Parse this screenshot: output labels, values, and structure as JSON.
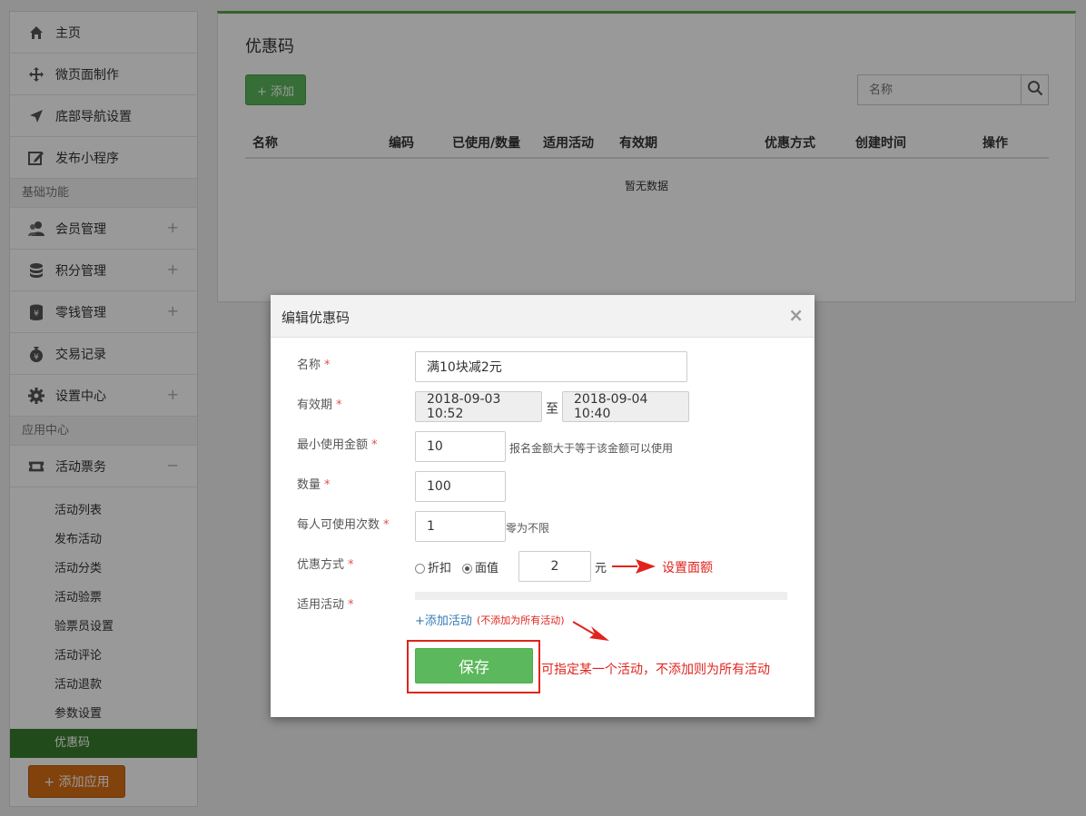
{
  "sidebar": {
    "items": [
      {
        "label": "主页",
        "icon": "home-icon"
      },
      {
        "label": "微页面制作",
        "icon": "move-icon"
      },
      {
        "label": "底部导航设置",
        "icon": "navigation-arrow-icon"
      },
      {
        "label": "发布小程序",
        "icon": "edit-square-icon"
      }
    ],
    "section1": "基础功能",
    "basic": [
      {
        "label": "会员管理",
        "icon": "users-icon",
        "expand": "+"
      },
      {
        "label": "积分管理",
        "icon": "coins-stack-icon",
        "expand": "+"
      },
      {
        "label": "零钱管理",
        "icon": "wallet-icon",
        "expand": "+"
      },
      {
        "label": "交易记录",
        "icon": "money-bag-icon"
      },
      {
        "label": "设置中心",
        "icon": "gear-icon",
        "expand": "+"
      }
    ],
    "section2": "应用中心",
    "app": {
      "label": "活动票务",
      "icon": "ticket-icon",
      "expand": "−"
    },
    "subitems": [
      "活动列表",
      "发布活动",
      "活动分类",
      "活动验票",
      "验票员设置",
      "活动评论",
      "活动退款",
      "参数设置",
      "优惠码"
    ],
    "active_index": 8,
    "add_app": "+ 添加应用"
  },
  "main": {
    "title": "优惠码",
    "add_button": "+ 添加",
    "search_placeholder": "名称",
    "columns": [
      "名称",
      "编码",
      "已使用/数量",
      "适用活动",
      "有效期",
      "优惠方式",
      "创建时间",
      "操作"
    ],
    "empty_text": "暂无数据"
  },
  "modal": {
    "title": "编辑优惠码",
    "close": "×",
    "required_mark": "*",
    "fields": {
      "name": {
        "label": "名称",
        "value": "满10块减2元"
      },
      "validity": {
        "label": "有效期",
        "start": "2018-09-03 10:52",
        "sep": "至",
        "end": "2018-09-04 10:40"
      },
      "min_amount": {
        "label": "最小使用金额",
        "value": "10",
        "hint": "报名金额大于等于该金额可以使用"
      },
      "quantity": {
        "label": "数量",
        "value": "100"
      },
      "per_user": {
        "label": "每人可使用次数",
        "value": "1",
        "hint": "零为不限"
      },
      "discount": {
        "label": "优惠方式",
        "option1": "折扣",
        "option2": "面值",
        "selected": "面值",
        "value": "2",
        "unit": "元"
      },
      "activity": {
        "label": "适用活动",
        "add_link": "+添加活动",
        "note": "(不添加为所有活动)"
      }
    },
    "save": "保存"
  },
  "annotations": {
    "set_amount": "设置面额",
    "activity_note": "可指定某一个活动，不添加则为所有活动",
    "color": "#e0241d"
  },
  "colors": {
    "primary_green": "#5cb85c",
    "active_nav": "#3a7d2d",
    "add_app_orange": "#d96f15"
  }
}
